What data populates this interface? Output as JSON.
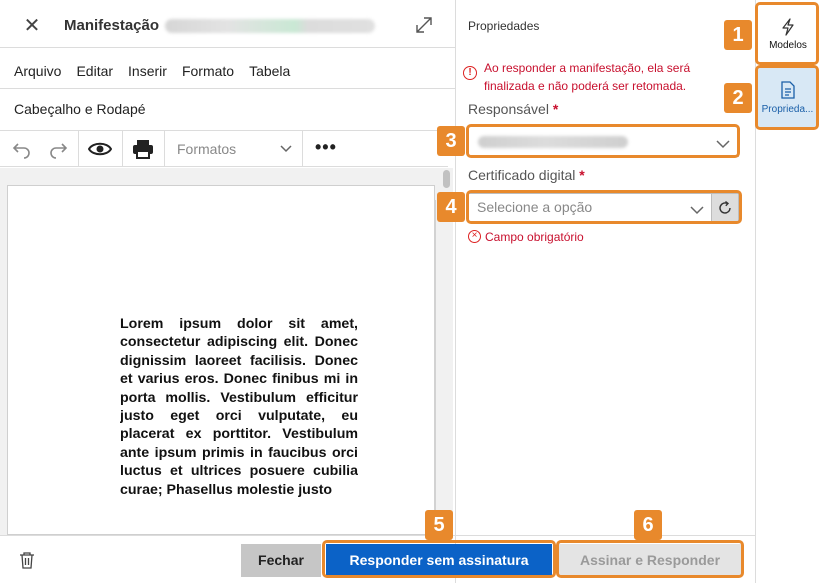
{
  "header": {
    "close_icon": "close-icon",
    "title": "Manifestação",
    "expand_icon": "expand-icon"
  },
  "menubar": [
    "Arquivo",
    "Editar",
    "Inserir",
    "Formato",
    "Tabela"
  ],
  "header_footer_link": "Cabeçalho e Rodapé",
  "toolbar": {
    "icons": [
      "undo-icon",
      "redo-icon",
      "preview-eye-icon",
      "print-icon",
      "more-icon"
    ],
    "formats_label": "Formatos",
    "more_label": "•••"
  },
  "document": {
    "text": "Lorem ipsum dolor sit amet, consectetur adipiscing elit. Donec dignissim laoreet facilisis. Donec et varius eros. Donec finibus mi in porta mollis. Vestibulum efficitur justo eget orci vulputate, eu placerat ex porttitor. Vestibulum ante ipsum primis in faucibus orci luctus et ultrices posuere cubilia curae; Phasellus molestie justo"
  },
  "properties": {
    "title": "Propriedades",
    "warning": "Ao responder a manifestação, ela será finalizada e não poderá ser retomada.",
    "responsavel_label": "Responsável",
    "required_mark": "*",
    "certificado_label": "Certificado digital",
    "certificado_placeholder": "Selecione a opção",
    "error_text": "Campo obrigatório"
  },
  "sidebar": {
    "modelos_label": "Modelos",
    "propriedades_label": "Proprieda..."
  },
  "footer": {
    "fechar": "Fechar",
    "responder": "Responder sem assinatura",
    "assinar": "Assinar e Responder"
  },
  "annotations": [
    "1",
    "2",
    "3",
    "4",
    "5",
    "6"
  ],
  "colors": {
    "accent_blue": "#0b62c7",
    "annotation_orange": "#e8892c",
    "error_red": "#c8102e",
    "selected_tab_bg": "#d8e8f5"
  }
}
